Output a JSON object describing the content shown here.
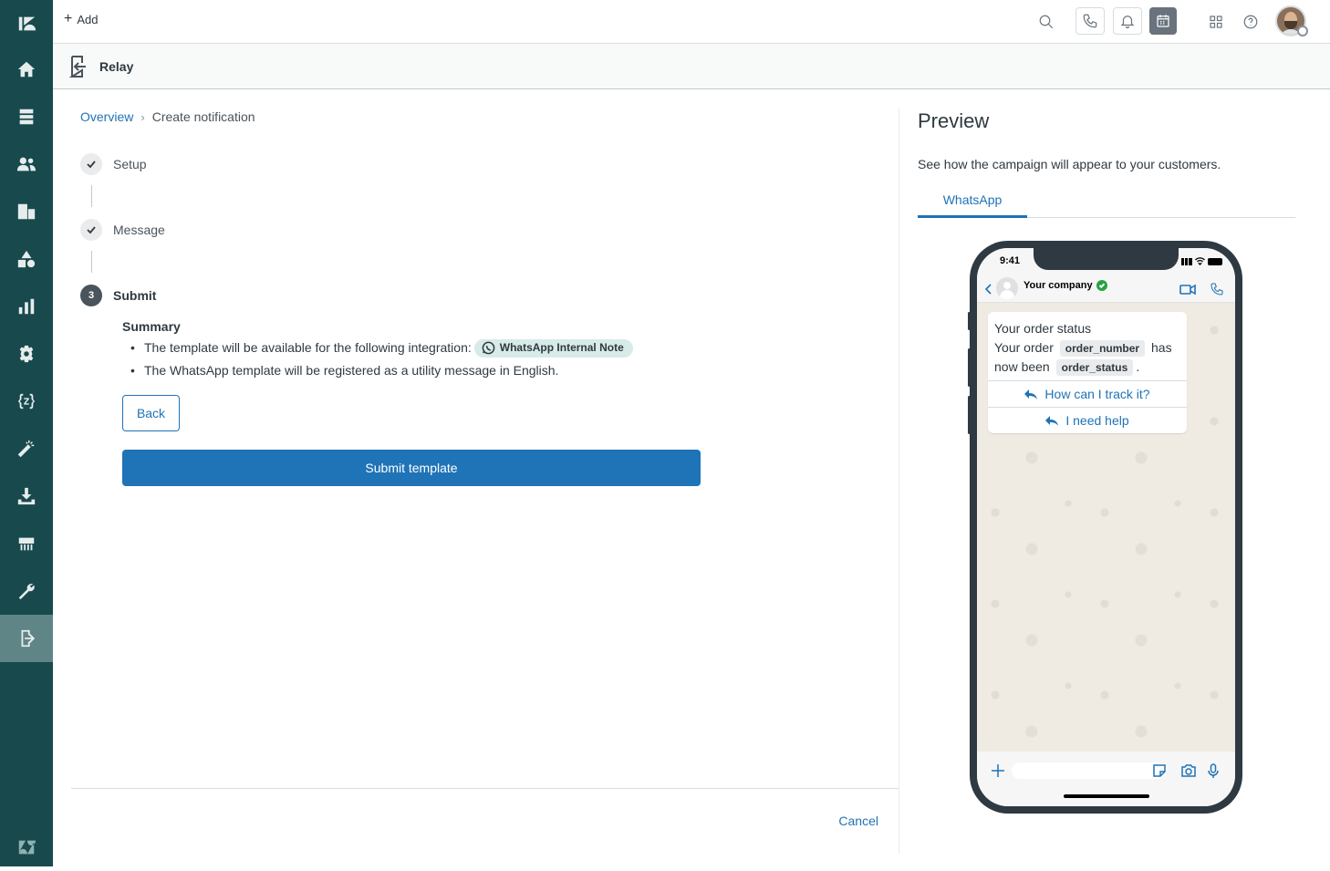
{
  "topbar": {
    "add_label": "Add"
  },
  "subheader": {
    "title": "Relay"
  },
  "breadcrumb": {
    "overview": "Overview",
    "current": "Create notification"
  },
  "steps": [
    {
      "label": "Setup",
      "state": "done"
    },
    {
      "label": "Message",
      "state": "done"
    },
    {
      "label": "Submit",
      "number": "3",
      "state": "active"
    }
  ],
  "summary": {
    "heading": "Summary",
    "item1": "The template will be available for the following integration:",
    "integration": "WhatsApp Internal Note",
    "item2": "The WhatsApp template will be registered as a utility message in English."
  },
  "buttons": {
    "back": "Back",
    "submit": "Submit template",
    "cancel": "Cancel"
  },
  "preview": {
    "title": "Preview",
    "description": "See how the campaign will appear to your customers.",
    "tab": "WhatsApp"
  },
  "phone": {
    "time": "9:41",
    "company": "Your company",
    "message_title": "Your order status",
    "msg_part1": "Your order",
    "var1": "order_number",
    "msg_part2": "has now been",
    "var2": "order_status",
    "msg_end": ".",
    "reply1": "How can I track it?",
    "reply2": "I need help"
  },
  "colors": {
    "nav_bg": "#17494d",
    "accent": "#1f73b7",
    "pill_bg": "#d7ebe9",
    "verified": "#25a244"
  }
}
